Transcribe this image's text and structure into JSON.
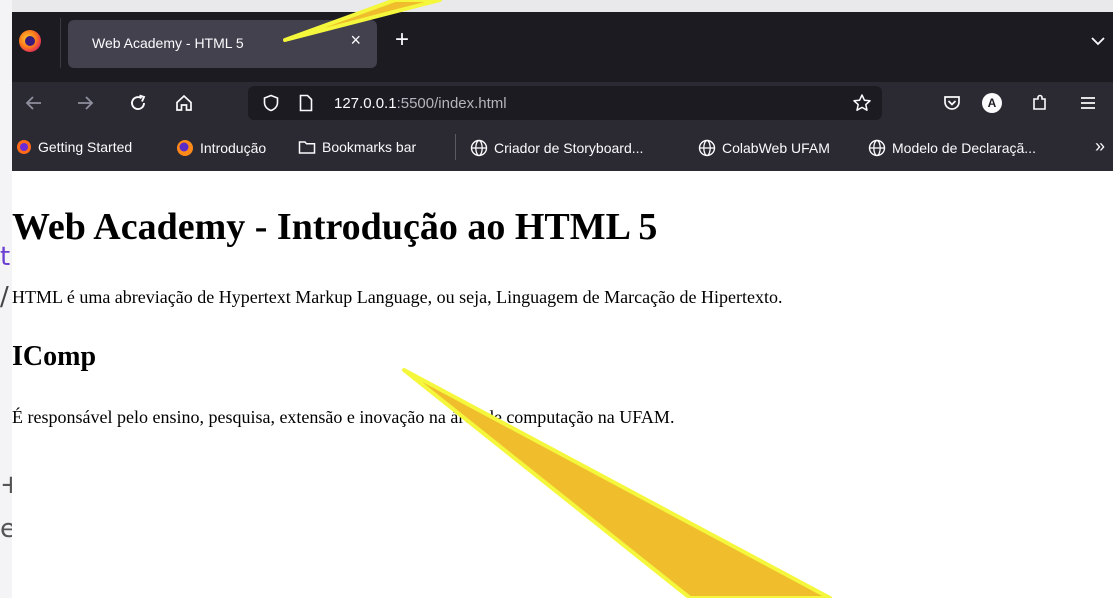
{
  "background_fragments": [
    "t",
    "/",
    "+",
    "e"
  ],
  "tab": {
    "title": "Web Academy - HTML 5",
    "close_glyph": "×",
    "new_tab_glyph": "+"
  },
  "address_bar": {
    "host": "127.0.0.1",
    "port_path": ":5500/index.html"
  },
  "bookmarks": {
    "items": [
      "Getting Started",
      "Introdução",
      "Bookmarks bar",
      "Criador de Storyboard...",
      "ColabWeb UFAM",
      "Modelo de Declaraçã..."
    ],
    "overflow_glyph": "»"
  },
  "page": {
    "heading": "Web Academy - Introdução ao HTML 5",
    "paragraph1": "HTML é uma abreviação de Hypertext Markup Language, ou seja, Linguagem de Marcação de Hipertexto.",
    "subheading": "IComp",
    "paragraph2": "É responsável pelo ensino, pesquisa, extensão e inovação na área de computação na UFAM."
  },
  "annotation_colors": {
    "arrow_fill": "#f0bd2c",
    "arrow_outline": "#f4f73c"
  },
  "colors": {
    "tabbar": "#1c1b22",
    "toolbar": "#2b2a33",
    "active_tab": "#42414d",
    "text_light": "#fbfbfe"
  },
  "profile_initial": "A"
}
